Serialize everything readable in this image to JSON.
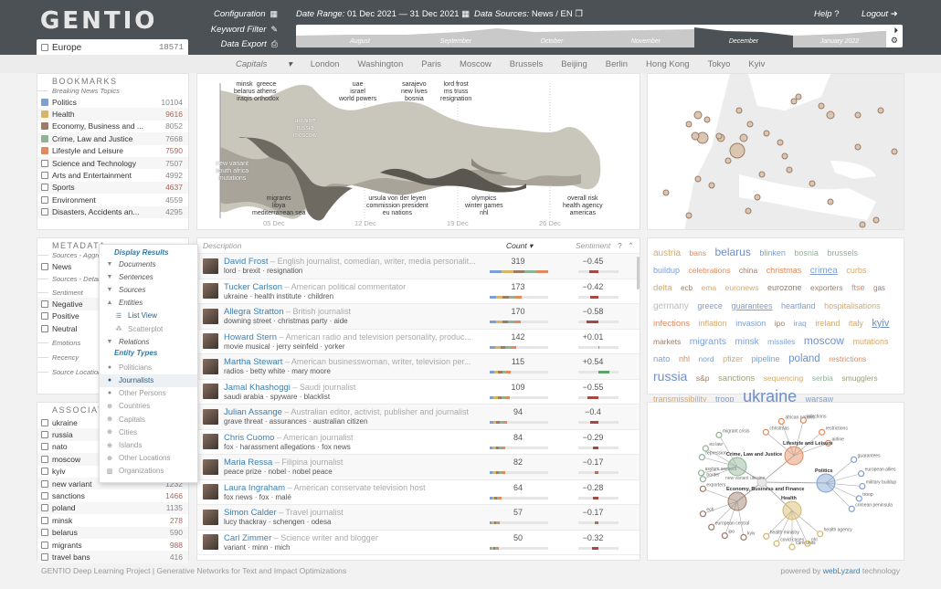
{
  "header": {
    "logo": "GENTIO",
    "region": {
      "label": "Europe",
      "count": "18571"
    },
    "menu": [
      {
        "label": "Configuration",
        "icon": "grid-icon"
      },
      {
        "label": "Keyword Filter",
        "icon": "edit-icon"
      },
      {
        "label": "Data Export",
        "icon": "download-icon"
      }
    ],
    "date_range_label": "Date Range:",
    "date_range_value": "01 Dec 2021 — 31 Dec 2021",
    "data_sources_label": "Data Sources:",
    "data_sources_value": "News / EN",
    "help": "Help",
    "logout": "Logout",
    "timeline_months": [
      "August",
      "September",
      "October",
      "November",
      "December",
      "January 2022"
    ],
    "timeline_selected": "December"
  },
  "nav": {
    "selected": "Capitals",
    "items": [
      "London",
      "Washington",
      "Paris",
      "Moscow",
      "Brussels",
      "Beijing",
      "Berlin",
      "Hong Kong",
      "Tokyo",
      "Kyiv"
    ]
  },
  "bookmarks": {
    "title": "BOOKMARKS",
    "subtitle": "Breaking News Topics",
    "items": [
      {
        "label": "Politics",
        "count": "10104",
        "color": "#7d9fd3"
      },
      {
        "label": "Health",
        "count": "9616",
        "color": "#d6b566"
      },
      {
        "label": "Economy, Business and ...",
        "count": "8052",
        "color": "#9c7b68"
      },
      {
        "label": "Crime, Law and Justice",
        "count": "7668",
        "color": "#8fb394"
      },
      {
        "label": "Lifestyle and Leisure",
        "count": "7590",
        "color": "#e08a5e"
      },
      {
        "label": "Science and Technology",
        "count": "7507",
        "color": ""
      },
      {
        "label": "Arts and Entertainment",
        "count": "4992",
        "color": ""
      },
      {
        "label": "Sports",
        "count": "4637",
        "color": ""
      },
      {
        "label": "Environment",
        "count": "4559",
        "color": ""
      },
      {
        "label": "Disasters, Accidents an...",
        "count": "4295",
        "color": ""
      }
    ]
  },
  "metadata": {
    "title": "METADATA",
    "sources_aggr": "Sources - Aggre",
    "news": "News",
    "sources_detail": "Sources - Detail",
    "sentiment": "Sentiment",
    "sentiment_items": [
      "Negative",
      "Positive",
      "Neutral"
    ],
    "emotions": "Emotions",
    "recency": "Recency",
    "source_location": "Source Location"
  },
  "dropdown": {
    "display_results": "Display Results",
    "items": [
      "Documents",
      "Sentences",
      "Sources",
      "Entities"
    ],
    "list_view": "List View",
    "scatterplot": "Scatterplot",
    "relations": "Relations",
    "entity_types": "Entity Types",
    "types": [
      {
        "label": "Politicians",
        "icon": "person-icon"
      },
      {
        "label": "Journalists",
        "icon": "person-icon",
        "selected": true
      },
      {
        "label": "Other Persons",
        "icon": "person-icon"
      },
      {
        "label": "Countries",
        "icon": "globe-icon"
      },
      {
        "label": "Capitals",
        "icon": "globe-icon"
      },
      {
        "label": "Cities",
        "icon": "globe-icon"
      },
      {
        "label": "Islands",
        "icon": "globe-icon"
      },
      {
        "label": "Other Locations",
        "icon": "globe-icon"
      },
      {
        "label": "Organizations",
        "icon": "building-icon"
      }
    ]
  },
  "associations": {
    "title": "ASSOCIATIONS",
    "items": [
      {
        "label": "ukraine",
        "count": ""
      },
      {
        "label": "russia",
        "count": ""
      },
      {
        "label": "nato",
        "count": ""
      },
      {
        "label": "moscow",
        "count": ""
      },
      {
        "label": "kyiv",
        "count": ""
      },
      {
        "label": "new variant",
        "count": "1232"
      },
      {
        "label": "sanctions",
        "count": "1466"
      },
      {
        "label": "poland",
        "count": "1135"
      },
      {
        "label": "minsk",
        "count": "278"
      },
      {
        "label": "belarus",
        "count": "590"
      },
      {
        "label": "migrants",
        "count": "988"
      },
      {
        "label": "travel bans",
        "count": "416"
      }
    ]
  },
  "stream": {
    "labels_top": [
      {
        "text": "minsk\nbelarus\niraqis"
      },
      {
        "text": "greece\nathens\northodox"
      },
      {
        "text": "uae\nisrael\nworld powers"
      },
      {
        "text": "sarajevo\nnew lives\nbosnia"
      },
      {
        "text": "lord frost\nms truss\nresignation"
      }
    ],
    "labels_mid": [
      {
        "text": "ukraine\nrussia\nmoscow"
      },
      {
        "text": "new variant\nsouth africa\nmutations"
      }
    ],
    "labels_bottom": [
      {
        "text": "migrants\nlibya\nmediterranean sea"
      },
      {
        "text": "ursula von der leyen\ncommission president\neu nations"
      },
      {
        "text": "olympics\nwinter games\nnhl"
      },
      {
        "text": "overall risk\nhealth agency\namericas"
      }
    ],
    "ticks": [
      "05 Dec",
      "12 Dec",
      "19 Dec",
      "26 Dec"
    ]
  },
  "list": {
    "col_description": "Description",
    "col_count": "Count",
    "col_sentiment": "Sentiment",
    "rows": [
      {
        "name": "David Frost",
        "desc": "English journalist, comedian, writer, media personalit...",
        "kw": "lord · brexit · resignation",
        "count": "319",
        "sent": "−0.45",
        "cnt_frac": 1.0,
        "s": -0.45
      },
      {
        "name": "Tucker Carlson",
        "desc": "American political commentator",
        "kw": "ukraine · health institute · children",
        "count": "173",
        "sent": "−0.42",
        "cnt_frac": 0.54,
        "s": -0.42
      },
      {
        "name": "Allegra Stratton",
        "desc": "British journalist",
        "kw": "downing street · christmas party · aide",
        "count": "170",
        "sent": "−0.58",
        "cnt_frac": 0.53,
        "s": -0.58
      },
      {
        "name": "Howard Stern",
        "desc": "American radio and television personality, produc...",
        "kw": "movie musical · jerry seinfeld · yorker",
        "count": "142",
        "sent": "+0.01",
        "cnt_frac": 0.45,
        "s": 0.01
      },
      {
        "name": "Martha Stewart",
        "desc": "American businesswoman, writer, television per...",
        "kw": "radios · betty white · mary moore",
        "count": "115",
        "sent": "+0.54",
        "cnt_frac": 0.36,
        "s": 0.54
      },
      {
        "name": "Jamal Khashoggi",
        "desc": "Saudi journalist",
        "kw": "saudi arabia · spyware · blacklist",
        "count": "109",
        "sent": "−0.55",
        "cnt_frac": 0.34,
        "s": -0.55
      },
      {
        "name": "Julian Assange",
        "desc": "Australian editor, activist, publisher and journalist",
        "kw": "grave threat · assurances · australian citizen",
        "count": "94",
        "sent": "−0.4",
        "cnt_frac": 0.29,
        "s": -0.4
      },
      {
        "name": "Chris Cuomo",
        "desc": "American journalist",
        "kw": "fox · harassment allegations · fox news",
        "count": "84",
        "sent": "−0.29",
        "cnt_frac": 0.26,
        "s": -0.29
      },
      {
        "name": "Maria Ressa",
        "desc": "Filipina journalist",
        "kw": "peace prize · nobel · nobel peace",
        "count": "82",
        "sent": "−0.17",
        "cnt_frac": 0.26,
        "s": -0.17
      },
      {
        "name": "Laura Ingraham",
        "desc": "American conservate television host",
        "kw": "fox news · fox · malé",
        "count": "64",
        "sent": "−0.28",
        "cnt_frac": 0.2,
        "s": -0.28
      },
      {
        "name": "Simon Calder",
        "desc": "Travel journalist",
        "kw": "lucy thackray · schengen · odesa",
        "count": "57",
        "sent": "−0.17",
        "cnt_frac": 0.18,
        "s": -0.17
      },
      {
        "name": "Carl Zimmer",
        "desc": "Science writer and blogger",
        "kw": "variant · minn · mich",
        "count": "50",
        "sent": "−0.32",
        "cnt_frac": 0.16,
        "s": -0.32
      }
    ]
  },
  "cloud": [
    {
      "t": "austria",
      "c": "#d4a86b",
      "s": 10
    },
    {
      "t": "bans",
      "c": "#e08a5e",
      "s": 8.5
    },
    {
      "t": "belarus",
      "c": "#6f8fc9",
      "s": 12
    },
    {
      "t": "blinken",
      "c": "#7d9fd3",
      "s": 9
    },
    {
      "t": "bosnia",
      "c": "#8fb394",
      "s": 9
    },
    {
      "t": "brussels",
      "c": "#8fb394",
      "s": 9
    },
    {
      "t": "buildup",
      "c": "#7d9fd3",
      "s": 9
    },
    {
      "t": "celebrations",
      "c": "#e08a5e",
      "s": 8.5
    },
    {
      "t": "china",
      "c": "#9c7b68",
      "s": 8.5
    },
    {
      "t": "christmas",
      "c": "#e08a5e",
      "s": 9
    },
    {
      "t": "crimea",
      "c": "#7d9fd3",
      "s": 10,
      "u": true
    },
    {
      "t": "curbs",
      "c": "#d4a86b",
      "s": 9
    },
    {
      "t": "delta",
      "c": "#d4a86b",
      "s": 9.5
    },
    {
      "t": "ecb",
      "c": "#9c7b68",
      "s": 8
    },
    {
      "t": "ema",
      "c": "#d4a86b",
      "s": 8.5
    },
    {
      "t": "euronews",
      "c": "#d4a86b",
      "s": 8.5
    },
    {
      "t": "eurozone",
      "c": "#9c7b68",
      "s": 9
    },
    {
      "t": "exporters",
      "c": "#9c7b68",
      "s": 8.5
    },
    {
      "t": "ftse",
      "c": "#e08a5e",
      "s": 9
    },
    {
      "t": "gas",
      "c": "#9c7b68",
      "s": 8
    },
    {
      "t": "germany",
      "c": "#bbb",
      "s": 10
    },
    {
      "t": "greece",
      "c": "#7d9fd3",
      "s": 9
    },
    {
      "t": "guarantees",
      "c": "#7d9fd3",
      "s": 9,
      "u": true
    },
    {
      "t": "heartland",
      "c": "#7d9fd3",
      "s": 9
    },
    {
      "t": "hospitalisations",
      "c": "#d4a86b",
      "s": 9
    },
    {
      "t": "infections",
      "c": "#e08a5e",
      "s": 9.5
    },
    {
      "t": "inflation",
      "c": "#d4a86b",
      "s": 9
    },
    {
      "t": "invasion",
      "c": "#7d9fd3",
      "s": 9
    },
    {
      "t": "ipo",
      "c": "#9c7b68",
      "s": 8.5
    },
    {
      "t": "iraq",
      "c": "#7d9fd3",
      "s": 8.5
    },
    {
      "t": "ireland",
      "c": "#d4a86b",
      "s": 9
    },
    {
      "t": "italy",
      "c": "#d4a86b",
      "s": 9
    },
    {
      "t": "kyiv",
      "c": "#6f8fc9",
      "s": 11,
      "u": true
    },
    {
      "t": "markets",
      "c": "#9c7b68",
      "s": 8.5
    },
    {
      "t": "migrants",
      "c": "#7d9fd3",
      "s": 10.5
    },
    {
      "t": "minsk",
      "c": "#7d9fd3",
      "s": 10
    },
    {
      "t": "missiles",
      "c": "#7d9fd3",
      "s": 8.5
    },
    {
      "t": "moscow",
      "c": "#6f8fc9",
      "s": 12
    },
    {
      "t": "mutations",
      "c": "#d4a86b",
      "s": 9
    },
    {
      "t": "nato",
      "c": "#7d9fd3",
      "s": 9.5
    },
    {
      "t": "nhl",
      "c": "#e08a5e",
      "s": 9
    },
    {
      "t": "nord",
      "c": "#7d9fd3",
      "s": 8.5
    },
    {
      "t": "pfizer",
      "c": "#d4a86b",
      "s": 9
    },
    {
      "t": "pipeline",
      "c": "#7d9fd3",
      "s": 9
    },
    {
      "t": "poland",
      "c": "#6f8fc9",
      "s": 11.5
    },
    {
      "t": "restrictions",
      "c": "#e08a5e",
      "s": 8.5
    },
    {
      "t": "russia",
      "c": "#6f8fc9",
      "s": 14
    },
    {
      "t": "s&p",
      "c": "#9c7b68",
      "s": 8.5
    },
    {
      "t": "sanctions",
      "c": "#9c9c7b",
      "s": 9.5
    },
    {
      "t": "sequencing",
      "c": "#d4a86b",
      "s": 8.5
    },
    {
      "t": "serbia",
      "c": "#8fb394",
      "s": 8.5
    },
    {
      "t": "smugglers",
      "c": "#9c9c7b",
      "s": 8.5
    },
    {
      "t": "transmissibility",
      "c": "#d4a86b",
      "s": 9
    },
    {
      "t": "troop",
      "c": "#7d9fd3",
      "s": 9
    },
    {
      "t": "ukraine",
      "c": "#6f8fc9",
      "s": 18
    },
    {
      "t": "warsaw",
      "c": "#7d9fd3",
      "s": 9
    }
  ],
  "network": {
    "hubs": [
      {
        "label": "Crime, Law\nand Justice",
        "color": "#8fb394",
        "leaves": [
          "migrant\ncrisis",
          "eu law",
          "repression",
          "asylum seekers",
          "border"
        ]
      },
      {
        "label": "Lifestyle\nand Leisure",
        "color": "#e08a5e",
        "leaves": [
          "african\nnations",
          "infections",
          "restrictions",
          "christmas",
          "airline"
        ]
      },
      {
        "label": "Politics",
        "color": "#7d9fd3",
        "leaves": [
          "guarantees",
          "european\nallies",
          "military\nbuildup",
          "troop",
          "crimean\npeninsula"
        ]
      },
      {
        "label": "Economy,\nBusiness and\nFinance",
        "color": "#9c7b68",
        "leaves": [
          "exporters",
          "ecb",
          "european\ncentral",
          "ipo",
          "kyiv"
        ]
      },
      {
        "label": "Health",
        "color": "#d6b566",
        "leaves": [
          "health\nagency",
          "nhl",
          "care units",
          "covid cases",
          "health\nministry"
        ]
      }
    ],
    "center": [
      "new variant",
      "ukraine"
    ]
  },
  "footer": {
    "left": "GENTIO Deep Learning Project | Generative Networks for Text and Impact Optimizations",
    "powered_prefix": "powered by ",
    "powered_brand": "webLyzard",
    "powered_suffix": " technology"
  }
}
